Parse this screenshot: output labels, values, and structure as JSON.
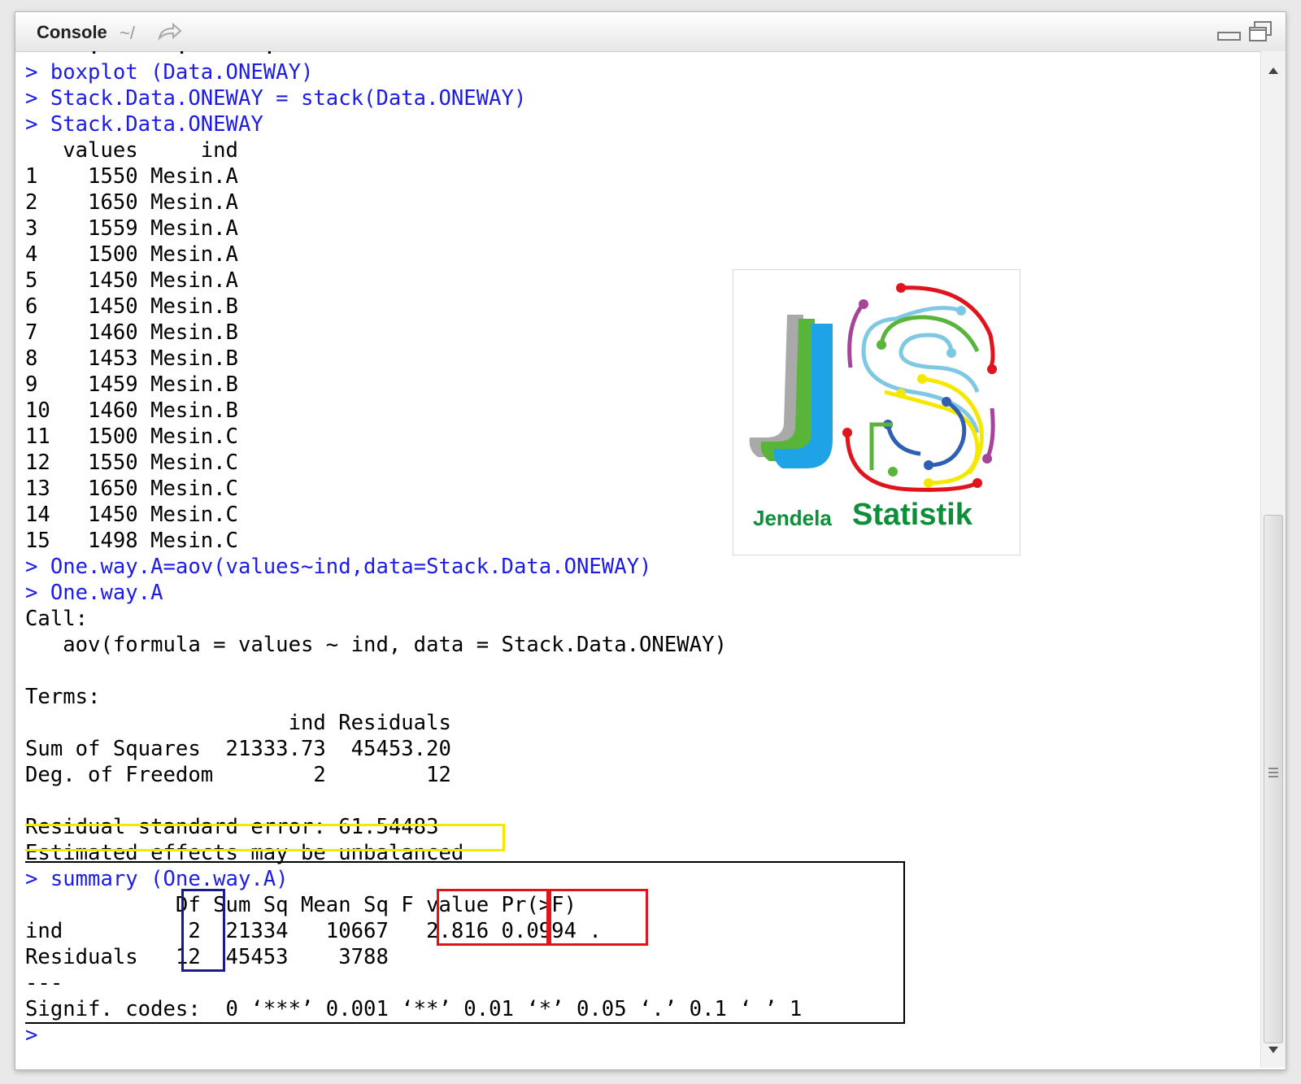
{
  "titlebar": {
    "title": "Console",
    "path": "~/",
    "icons": [
      "go-to-directory-icon",
      "minimize-icon",
      "maximize-icon"
    ]
  },
  "console": {
    "prompt_char": ">",
    "partial_top_line": "-   -.--   -.--   -.--",
    "lines": [
      {
        "text": "> boxplot (Data.ONEWAY)",
        "type": "cmd"
      },
      {
        "text": "> Stack.Data.ONEWAY = stack(Data.ONEWAY)",
        "type": "cmd"
      },
      {
        "text": "> Stack.Data.ONEWAY",
        "type": "cmd"
      },
      {
        "text": "   values     ind",
        "type": "out"
      },
      {
        "text": "1    1550 Mesin.A",
        "type": "out"
      },
      {
        "text": "2    1650 Mesin.A",
        "type": "out"
      },
      {
        "text": "3    1559 Mesin.A",
        "type": "out"
      },
      {
        "text": "4    1500 Mesin.A",
        "type": "out"
      },
      {
        "text": "5    1450 Mesin.A",
        "type": "out"
      },
      {
        "text": "6    1450 Mesin.B",
        "type": "out"
      },
      {
        "text": "7    1460 Mesin.B",
        "type": "out"
      },
      {
        "text": "8    1453 Mesin.B",
        "type": "out"
      },
      {
        "text": "9    1459 Mesin.B",
        "type": "out"
      },
      {
        "text": "10   1460 Mesin.B",
        "type": "out"
      },
      {
        "text": "11   1500 Mesin.C",
        "type": "out"
      },
      {
        "text": "12   1550 Mesin.C",
        "type": "out"
      },
      {
        "text": "13   1650 Mesin.C",
        "type": "out"
      },
      {
        "text": "14   1450 Mesin.C",
        "type": "out"
      },
      {
        "text": "15   1498 Mesin.C",
        "type": "out"
      },
      {
        "text": "> One.way.A=aov(values~ind,data=Stack.Data.ONEWAY)",
        "type": "cmd"
      },
      {
        "text": "> One.way.A",
        "type": "cmd"
      },
      {
        "text": "Call:",
        "type": "out"
      },
      {
        "text": "   aov(formula = values ~ ind, data = Stack.Data.ONEWAY)",
        "type": "out"
      },
      {
        "text": "",
        "type": "out"
      },
      {
        "text": "Terms:",
        "type": "out"
      },
      {
        "text": "                     ind Residuals",
        "type": "out"
      },
      {
        "text": "Sum of Squares  21333.73  45453.20",
        "type": "out"
      },
      {
        "text": "Deg. of Freedom        2        12",
        "type": "out"
      },
      {
        "text": "",
        "type": "out"
      },
      {
        "text": "Residual standard error: 61.54483",
        "type": "out"
      },
      {
        "text": "Estimated effects may be unbalanced",
        "type": "out"
      },
      {
        "text": "> summary (One.way.A)",
        "type": "cmd"
      },
      {
        "text": "            Df Sum Sq Mean Sq F value Pr(>F)",
        "type": "out"
      },
      {
        "text": "ind          2  21334   10667   2.816 0.0994 .",
        "type": "out"
      },
      {
        "text": "Residuals   12  45453    3788",
        "type": "out"
      },
      {
        "text": "---",
        "type": "out"
      },
      {
        "text": "Signif. codes:  0 ‘***’ 0.001 ‘**’ 0.01 ‘*’ 0.05 ‘.’ 0.1 ‘ ’ 1",
        "type": "out"
      },
      {
        "text": "> ",
        "type": "cmd"
      }
    ]
  },
  "highlight_colors": {
    "residual_error": "#f5e800",
    "summary_block": "#000000",
    "df_column": "#1a1a8c",
    "f_value": "#e0141c",
    "p_value": "#e0141c"
  },
  "logo": {
    "word1": "Jendela",
    "word2": "Statistik",
    "brand_green": "#0d8f3a",
    "brand_blue": "#1ea3e6"
  },
  "scrollbar": {
    "icons": [
      "scroll-up-arrow-icon",
      "scroll-down-arrow-icon",
      "grip-icon"
    ]
  }
}
